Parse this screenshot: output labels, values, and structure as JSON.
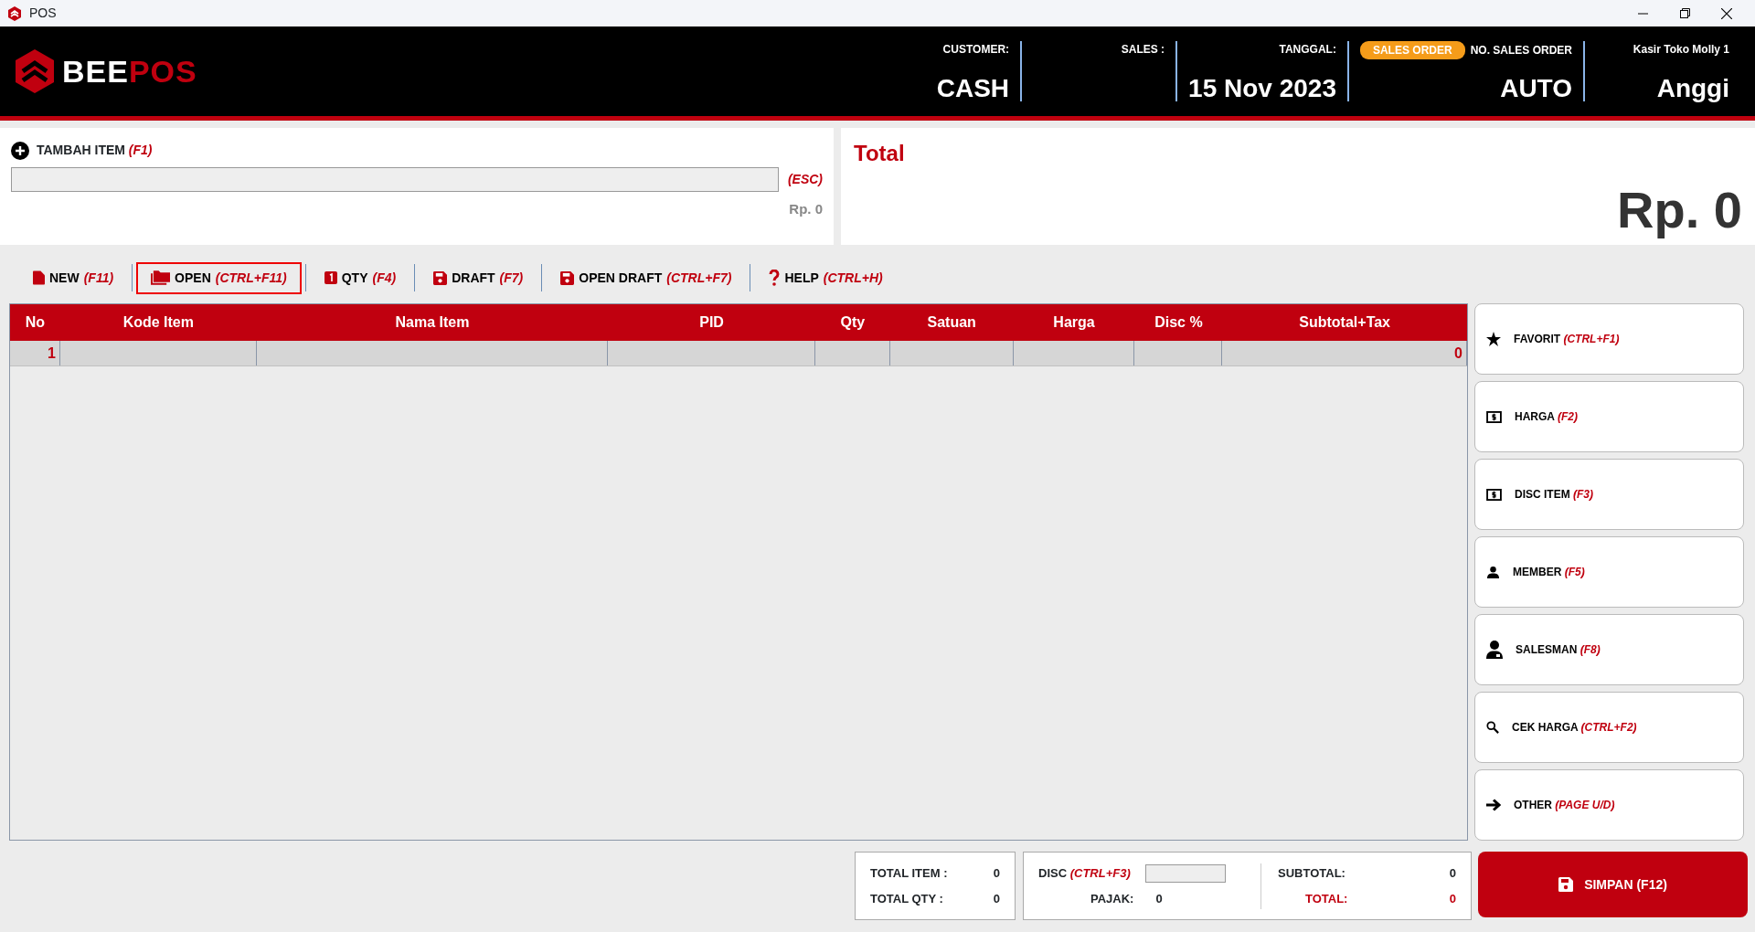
{
  "window": {
    "title": "POS"
  },
  "header": {
    "logo": {
      "part1": "BEE",
      "part2": "POS"
    },
    "fields": [
      {
        "kind": "plain",
        "label": "CUSTOMER:",
        "value": "CASH"
      },
      {
        "kind": "plain",
        "label": "SALES :"
      },
      {
        "kind": "plain",
        "label": "TANGGAL:",
        "value": "15 Nov 2023"
      },
      {
        "kind": "badge",
        "badge": "SALES ORDER",
        "label": "NO. SALES ORDER",
        "value": "AUTO"
      },
      {
        "kind": "plain",
        "label": "Kasir Toko Molly 1",
        "value": "Anggi"
      }
    ]
  },
  "add_item": {
    "label": "TAMBAH ITEM",
    "shortcut": "(F1)",
    "esc": "(ESC)",
    "price": "Rp. 0"
  },
  "total_panel": {
    "title": "Total",
    "amount": "Rp. 0"
  },
  "toolbar": [
    {
      "kind": "file",
      "label": "NEW",
      "shortcut": "(F11)",
      "selected": false
    },
    {
      "kind": "folder",
      "label": "OPEN",
      "shortcut": "(CTRL+F11)",
      "selected": true
    },
    {
      "kind": "one",
      "label": "QTY",
      "shortcut": "(F4)",
      "selected": false
    },
    {
      "kind": "disk",
      "label": "DRAFT",
      "shortcut": "(F7)",
      "selected": false
    },
    {
      "kind": "disk",
      "label": "OPEN DRAFT",
      "shortcut": "(CTRL+F7)",
      "selected": false
    },
    {
      "kind": "help",
      "label": "HELP",
      "shortcut": "(CTRL+H)",
      "selected": false
    }
  ],
  "table": {
    "columns": [
      "No",
      "Kode Item",
      "Nama Item",
      "PID",
      "Qty",
      "Satuan",
      "Harga",
      "Disc %",
      "Subtotal+Tax"
    ],
    "rows": [
      {
        "no": "1",
        "subtotal_tax": "0"
      }
    ]
  },
  "side_buttons": [
    {
      "kind": "star",
      "label": "FAVORIT",
      "shortcut": "(CTRL+F1)"
    },
    {
      "kind": "money",
      "label": "HARGA",
      "shortcut": "(F2)"
    },
    {
      "kind": "money",
      "label": "DISC ITEM",
      "shortcut": "(F3)"
    },
    {
      "kind": "person",
      "label": "MEMBER",
      "shortcut": "(F5)"
    },
    {
      "kind": "salesman",
      "label": "SALESMAN",
      "shortcut": "(F8)"
    },
    {
      "kind": "search",
      "label": "CEK HARGA",
      "shortcut": "(CTRL+F2)"
    },
    {
      "kind": "arrow",
      "label": "OTHER",
      "shortcut": "(PAGE U/D)"
    }
  ],
  "summary": {
    "total_item_label": "TOTAL ITEM :",
    "total_item": "0",
    "total_qty_label": "TOTAL QTY :",
    "total_qty": "0",
    "disc_label": "DISC",
    "disc_shortcut": "(CTRL+F3)",
    "pajak_label": "PAJAK:",
    "pajak": "0",
    "subtotal_label": "SUBTOTAL:",
    "subtotal": "0",
    "total_label": "TOTAL:",
    "total": "0"
  },
  "save_button": {
    "label": "SIMPAN (F12)"
  }
}
